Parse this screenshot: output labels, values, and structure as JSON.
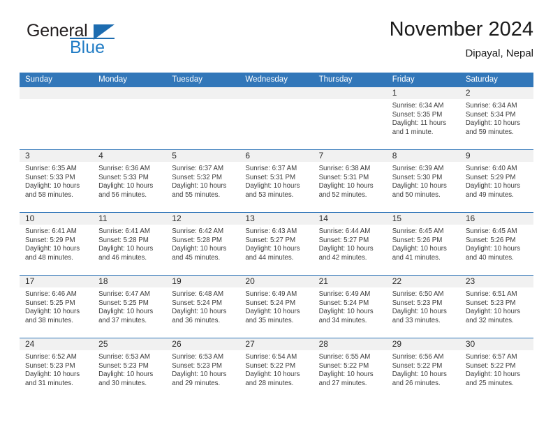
{
  "logo": {
    "word1": "General",
    "word2": "Blue",
    "triangle_color": "#1d6cb0",
    "blue_text_color": "#1f7bc4"
  },
  "header": {
    "title": "November 2024",
    "location": "Dipayal, Nepal",
    "header_bg": "#3277b9",
    "daynum_bg": "#f1f1f1"
  },
  "weekdays": [
    "Sunday",
    "Monday",
    "Tuesday",
    "Wednesday",
    "Thursday",
    "Friday",
    "Saturday"
  ],
  "labels": {
    "sunrise_prefix": "Sunrise: ",
    "sunset_prefix": "Sunset: ",
    "daylight_prefix": "Daylight: "
  },
  "weeks": [
    [
      {
        "day": "",
        "empty": true
      },
      {
        "day": "",
        "empty": true
      },
      {
        "day": "",
        "empty": true
      },
      {
        "day": "",
        "empty": true
      },
      {
        "day": "",
        "empty": true
      },
      {
        "day": "1",
        "sunrise": "Sunrise: 6:34 AM",
        "sunset": "Sunset: 5:35 PM",
        "daylight1": "Daylight: 11 hours",
        "daylight2": "and 1 minute."
      },
      {
        "day": "2",
        "sunrise": "Sunrise: 6:34 AM",
        "sunset": "Sunset: 5:34 PM",
        "daylight1": "Daylight: 10 hours",
        "daylight2": "and 59 minutes."
      }
    ],
    [
      {
        "day": "3",
        "sunrise": "Sunrise: 6:35 AM",
        "sunset": "Sunset: 5:33 PM",
        "daylight1": "Daylight: 10 hours",
        "daylight2": "and 58 minutes."
      },
      {
        "day": "4",
        "sunrise": "Sunrise: 6:36 AM",
        "sunset": "Sunset: 5:33 PM",
        "daylight1": "Daylight: 10 hours",
        "daylight2": "and 56 minutes."
      },
      {
        "day": "5",
        "sunrise": "Sunrise: 6:37 AM",
        "sunset": "Sunset: 5:32 PM",
        "daylight1": "Daylight: 10 hours",
        "daylight2": "and 55 minutes."
      },
      {
        "day": "6",
        "sunrise": "Sunrise: 6:37 AM",
        "sunset": "Sunset: 5:31 PM",
        "daylight1": "Daylight: 10 hours",
        "daylight2": "and 53 minutes."
      },
      {
        "day": "7",
        "sunrise": "Sunrise: 6:38 AM",
        "sunset": "Sunset: 5:31 PM",
        "daylight1": "Daylight: 10 hours",
        "daylight2": "and 52 minutes."
      },
      {
        "day": "8",
        "sunrise": "Sunrise: 6:39 AM",
        "sunset": "Sunset: 5:30 PM",
        "daylight1": "Daylight: 10 hours",
        "daylight2": "and 50 minutes."
      },
      {
        "day": "9",
        "sunrise": "Sunrise: 6:40 AM",
        "sunset": "Sunset: 5:29 PM",
        "daylight1": "Daylight: 10 hours",
        "daylight2": "and 49 minutes."
      }
    ],
    [
      {
        "day": "10",
        "sunrise": "Sunrise: 6:41 AM",
        "sunset": "Sunset: 5:29 PM",
        "daylight1": "Daylight: 10 hours",
        "daylight2": "and 48 minutes."
      },
      {
        "day": "11",
        "sunrise": "Sunrise: 6:41 AM",
        "sunset": "Sunset: 5:28 PM",
        "daylight1": "Daylight: 10 hours",
        "daylight2": "and 46 minutes."
      },
      {
        "day": "12",
        "sunrise": "Sunrise: 6:42 AM",
        "sunset": "Sunset: 5:28 PM",
        "daylight1": "Daylight: 10 hours",
        "daylight2": "and 45 minutes."
      },
      {
        "day": "13",
        "sunrise": "Sunrise: 6:43 AM",
        "sunset": "Sunset: 5:27 PM",
        "daylight1": "Daylight: 10 hours",
        "daylight2": "and 44 minutes."
      },
      {
        "day": "14",
        "sunrise": "Sunrise: 6:44 AM",
        "sunset": "Sunset: 5:27 PM",
        "daylight1": "Daylight: 10 hours",
        "daylight2": "and 42 minutes."
      },
      {
        "day": "15",
        "sunrise": "Sunrise: 6:45 AM",
        "sunset": "Sunset: 5:26 PM",
        "daylight1": "Daylight: 10 hours",
        "daylight2": "and 41 minutes."
      },
      {
        "day": "16",
        "sunrise": "Sunrise: 6:45 AM",
        "sunset": "Sunset: 5:26 PM",
        "daylight1": "Daylight: 10 hours",
        "daylight2": "and 40 minutes."
      }
    ],
    [
      {
        "day": "17",
        "sunrise": "Sunrise: 6:46 AM",
        "sunset": "Sunset: 5:25 PM",
        "daylight1": "Daylight: 10 hours",
        "daylight2": "and 38 minutes."
      },
      {
        "day": "18",
        "sunrise": "Sunrise: 6:47 AM",
        "sunset": "Sunset: 5:25 PM",
        "daylight1": "Daylight: 10 hours",
        "daylight2": "and 37 minutes."
      },
      {
        "day": "19",
        "sunrise": "Sunrise: 6:48 AM",
        "sunset": "Sunset: 5:24 PM",
        "daylight1": "Daylight: 10 hours",
        "daylight2": "and 36 minutes."
      },
      {
        "day": "20",
        "sunrise": "Sunrise: 6:49 AM",
        "sunset": "Sunset: 5:24 PM",
        "daylight1": "Daylight: 10 hours",
        "daylight2": "and 35 minutes."
      },
      {
        "day": "21",
        "sunrise": "Sunrise: 6:49 AM",
        "sunset": "Sunset: 5:24 PM",
        "daylight1": "Daylight: 10 hours",
        "daylight2": "and 34 minutes."
      },
      {
        "day": "22",
        "sunrise": "Sunrise: 6:50 AM",
        "sunset": "Sunset: 5:23 PM",
        "daylight1": "Daylight: 10 hours",
        "daylight2": "and 33 minutes."
      },
      {
        "day": "23",
        "sunrise": "Sunrise: 6:51 AM",
        "sunset": "Sunset: 5:23 PM",
        "daylight1": "Daylight: 10 hours",
        "daylight2": "and 32 minutes."
      }
    ],
    [
      {
        "day": "24",
        "sunrise": "Sunrise: 6:52 AM",
        "sunset": "Sunset: 5:23 PM",
        "daylight1": "Daylight: 10 hours",
        "daylight2": "and 31 minutes."
      },
      {
        "day": "25",
        "sunrise": "Sunrise: 6:53 AM",
        "sunset": "Sunset: 5:23 PM",
        "daylight1": "Daylight: 10 hours",
        "daylight2": "and 30 minutes."
      },
      {
        "day": "26",
        "sunrise": "Sunrise: 6:53 AM",
        "sunset": "Sunset: 5:23 PM",
        "daylight1": "Daylight: 10 hours",
        "daylight2": "and 29 minutes."
      },
      {
        "day": "27",
        "sunrise": "Sunrise: 6:54 AM",
        "sunset": "Sunset: 5:22 PM",
        "daylight1": "Daylight: 10 hours",
        "daylight2": "and 28 minutes."
      },
      {
        "day": "28",
        "sunrise": "Sunrise: 6:55 AM",
        "sunset": "Sunset: 5:22 PM",
        "daylight1": "Daylight: 10 hours",
        "daylight2": "and 27 minutes."
      },
      {
        "day": "29",
        "sunrise": "Sunrise: 6:56 AM",
        "sunset": "Sunset: 5:22 PM",
        "daylight1": "Daylight: 10 hours",
        "daylight2": "and 26 minutes."
      },
      {
        "day": "30",
        "sunrise": "Sunrise: 6:57 AM",
        "sunset": "Sunset: 5:22 PM",
        "daylight1": "Daylight: 10 hours",
        "daylight2": "and 25 minutes."
      }
    ]
  ]
}
